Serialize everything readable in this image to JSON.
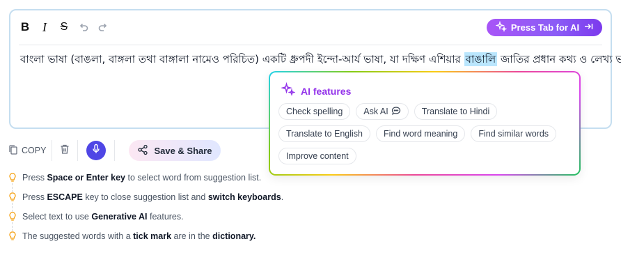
{
  "toolbar": {
    "bold_label": "B",
    "italic_label": "I",
    "strike_label": "S",
    "ai_button_label": "Press Tab for AI"
  },
  "editor": {
    "text_before": "বাংলা ভাষা (বাঙলা, বাঙ্গলা তথা বাঙ্গালা নামেও পরিচিত) একটি ধ্রুপদী ইন্দো-আর্য ভাষা, যা দক্ষিণ এশিয়ার ",
    "text_highlight": "বাঙালি",
    "text_after": " জাতির প্রধান কথ্য ও লেখ্য ভাষা।"
  },
  "ai_popup": {
    "title": "AI features",
    "chips": [
      {
        "label": "Check spelling"
      },
      {
        "label": "Ask AI"
      },
      {
        "label": "Translate to Hindi"
      },
      {
        "label": "Translate to English"
      },
      {
        "label": "Find word meaning"
      },
      {
        "label": "Find similar words"
      },
      {
        "label": "Improve content"
      }
    ]
  },
  "actions": {
    "copy_label": "COPY",
    "share_label": "Save & Share"
  },
  "tips": [
    {
      "parts": [
        "Press ",
        "Space or Enter key",
        " to select word from suggestion list.",
        "",
        ""
      ]
    },
    {
      "parts": [
        "Press ",
        "ESCAPE",
        " key to close suggestion list and ",
        "switch keyboards",
        "."
      ]
    },
    {
      "parts": [
        "Select text to use ",
        "Generative AI",
        " features.",
        "",
        ""
      ]
    },
    {
      "parts": [
        "The suggested words with a ",
        "tick mark",
        " are in the ",
        "dictionary.",
        ""
      ]
    }
  ],
  "colors": {
    "accent_purple": "#9333ea",
    "mic_indigo": "#4f46e5",
    "highlight": "#bae6fd",
    "bulb": "#f59e0b"
  },
  "icons": [
    "undo-icon",
    "redo-icon",
    "sparkle-icon",
    "tab-arrow-icon",
    "chat-bubble-icon",
    "copy-icon",
    "trash-icon",
    "mic-icon",
    "share-icon",
    "lightbulb-icon"
  ]
}
